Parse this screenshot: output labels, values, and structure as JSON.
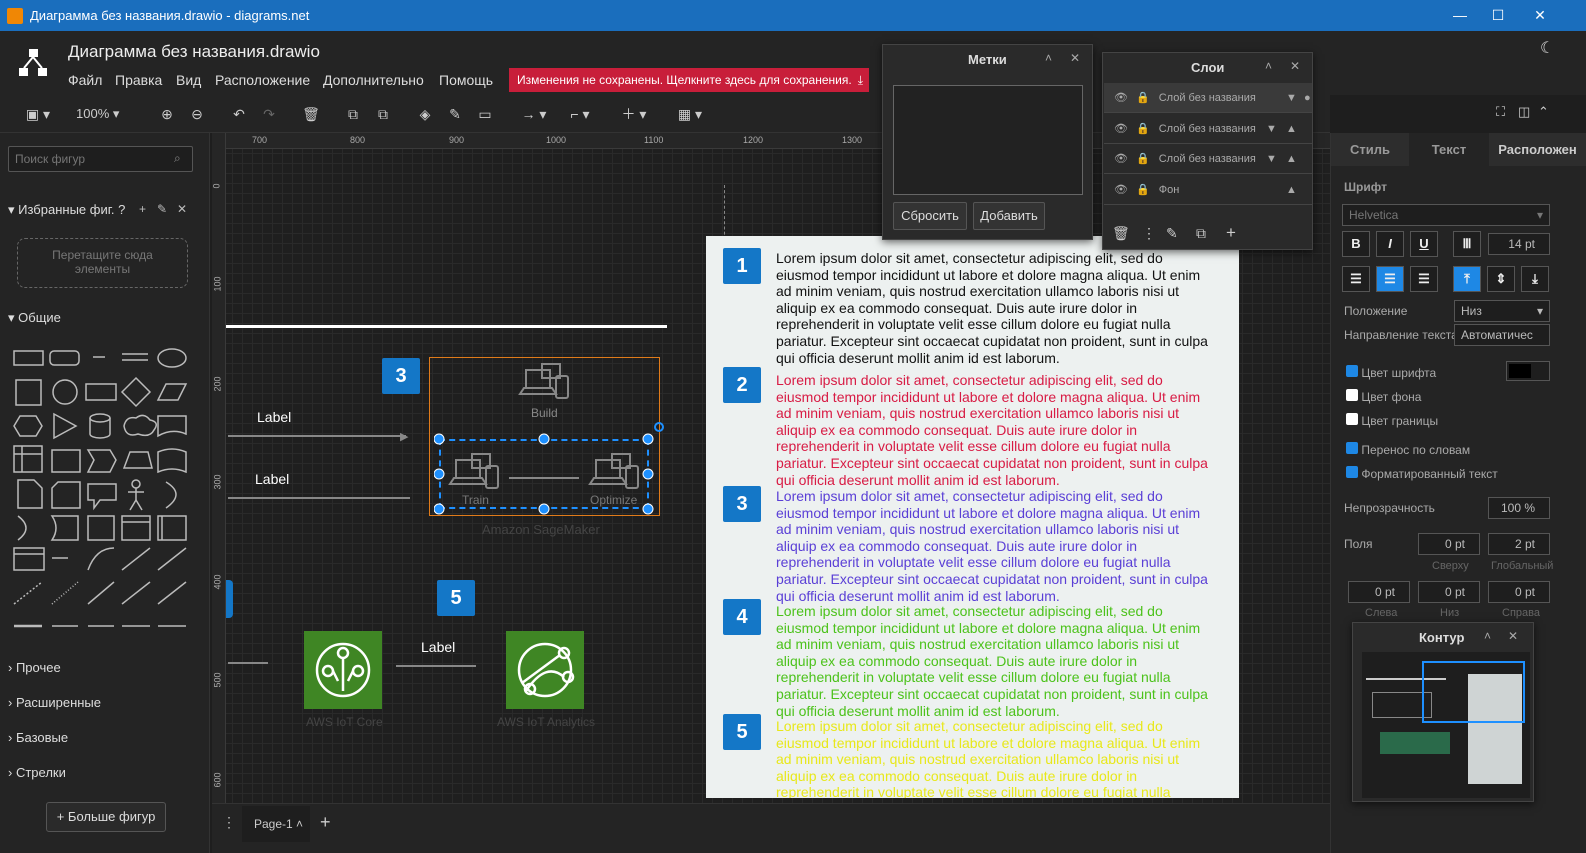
{
  "window": {
    "title": "Диаграмма без названия.drawio - diagrams.net"
  },
  "header": {
    "doc_title": "Диаграмма без названия.drawio",
    "menu": [
      "Файл",
      "Правка",
      "Вид",
      "Расположение",
      "Дополнительно",
      "Помощь"
    ],
    "save_banner": "Изменения не сохранены. Щелкните здесь для сохранения."
  },
  "toolbar": {
    "zoom": "100%"
  },
  "ruler": {
    "h_ticks": [
      "700",
      "800",
      "900",
      "1000",
      "1100",
      "1200",
      "1300"
    ],
    "v_ticks": [
      "0",
      "100",
      "200",
      "300",
      "400",
      "500",
      "600"
    ]
  },
  "sidebar": {
    "search_placeholder": "Поиск фигур",
    "favorites_title": "Избранные фиг.",
    "favorites_help": "?",
    "drop_hint": "Перетащите сюда элементы",
    "general": "Общие",
    "categories": [
      "Прочее",
      "Расширенные",
      "Базовые",
      "Стрелки"
    ],
    "more_shapes": "Больше фигур"
  },
  "tags_panel": {
    "title": "Метки",
    "reset": "Сбросить",
    "add": "Добавить"
  },
  "layers_panel": {
    "title": "Слои",
    "layers": [
      "Слой без названия",
      "Слой без названия",
      "Слой без названия",
      "Фон"
    ]
  },
  "right_panel": {
    "tabs": [
      "Стиль",
      "Текст",
      "Расположен"
    ],
    "font_label": "Шрифт",
    "font_name": "Helvetica",
    "bold": "B",
    "italic": "I",
    "underline": "U",
    "font_size": "14 pt",
    "position_label": "Положение",
    "position_value": "Низ",
    "direction_label": "Направление текста",
    "direction_value": "Автоматичес",
    "font_color": "Цвет шрифта",
    "bg_color": "Цвет фона",
    "border_color": "Цвет границы",
    "word_wrap": "Перенос по словам",
    "formatted": "Форматированный текст",
    "opacity_label": "Непрозрачность",
    "opacity_value": "100 %",
    "fields_label": "Поля",
    "field_top": "0 pt",
    "field_global": "2 pt",
    "top_label": "Сверху",
    "global_label": "Глобальный",
    "field_left": "0 pt",
    "field_bottom": "0 pt",
    "field_right": "0 pt",
    "left_label": "Слева",
    "bottom_label": "Низ",
    "right_label": "Справа"
  },
  "outline_panel": {
    "title": "Контур"
  },
  "diagram": {
    "label1": "Label",
    "label2": "Label",
    "label3": "Label",
    "badge3": "3",
    "badge5": "5",
    "build": "Build",
    "train": "Train",
    "optimize": "Optimize",
    "sagemaker": "Amazon SageMaker",
    "iot_core": "AWS IoT Core",
    "iot_analytics": "AWS IoT Analytics",
    "steps": [
      {
        "n": "1",
        "color": "#111111"
      },
      {
        "n": "2",
        "color": "#d81b44"
      },
      {
        "n": "3",
        "color": "#5a3fd6"
      },
      {
        "n": "4",
        "color": "#4cc21b"
      },
      {
        "n": "5",
        "color": "#e8e81a"
      }
    ],
    "lorem": "Lorem ipsum dolor sit amet, consectetur adipiscing elit, sed do eiusmod tempor incididunt ut labore et dolore magna aliqua. Ut enim ad minim veniam, quis nostrud exercitation ullamco laboris nisi ut aliquip ex ea commodo consequat. Duis aute irure dolor in reprehenderit in voluptate velit esse cillum dolore eu fugiat nulla pariatur. Excepteur sint occaecat cupidatat non proident, sunt in culpa qui officia deserunt mollit anim id est laborum."
  },
  "bottom": {
    "page": "Page-1"
  },
  "colors": {
    "accent": "#1a6ebd",
    "save_banner": "#c81e3a",
    "badge": "#1477c7",
    "iot_green": "#3f8624"
  }
}
